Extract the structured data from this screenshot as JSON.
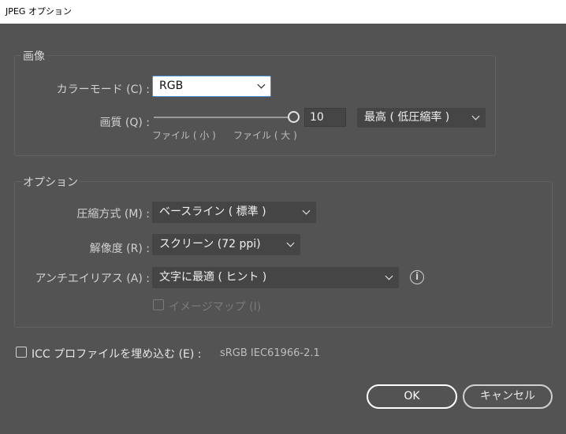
{
  "window": {
    "title": "JPEG オプション"
  },
  "image_group": {
    "title": "画像",
    "color_mode": {
      "label": "カラーモード (C) :",
      "value": "RGB"
    },
    "quality": {
      "label": "画質 (Q) :",
      "slider_level": 1.0,
      "value": "10",
      "preset": "最高 ( 低圧縮率 )",
      "small_label": "ファイル ( 小 )",
      "large_label": "ファイル ( 大 )"
    }
  },
  "options_group": {
    "title": "オプション",
    "compression": {
      "label": "圧縮方式 (M) :",
      "value": "ベースライン ( 標準 )"
    },
    "resolution": {
      "label": "解像度 (R) :",
      "value": "スクリーン (72 ppi)"
    },
    "antialias": {
      "label": "アンチエイリアス (A) :",
      "value": "文字に最適 ( ヒント )"
    },
    "imagemap": {
      "label": "イメージマップ (I)",
      "checked": false,
      "enabled": false
    }
  },
  "icc": {
    "label": "ICC プロファイルを埋め込む (E) :",
    "profile": "sRGB IEC61966-2.1",
    "checked": false
  },
  "buttons": {
    "ok": "OK",
    "cancel": "キャンセル"
  },
  "colors": {
    "background": "#535353",
    "focus": "#4a90d9",
    "field": "#454545"
  }
}
